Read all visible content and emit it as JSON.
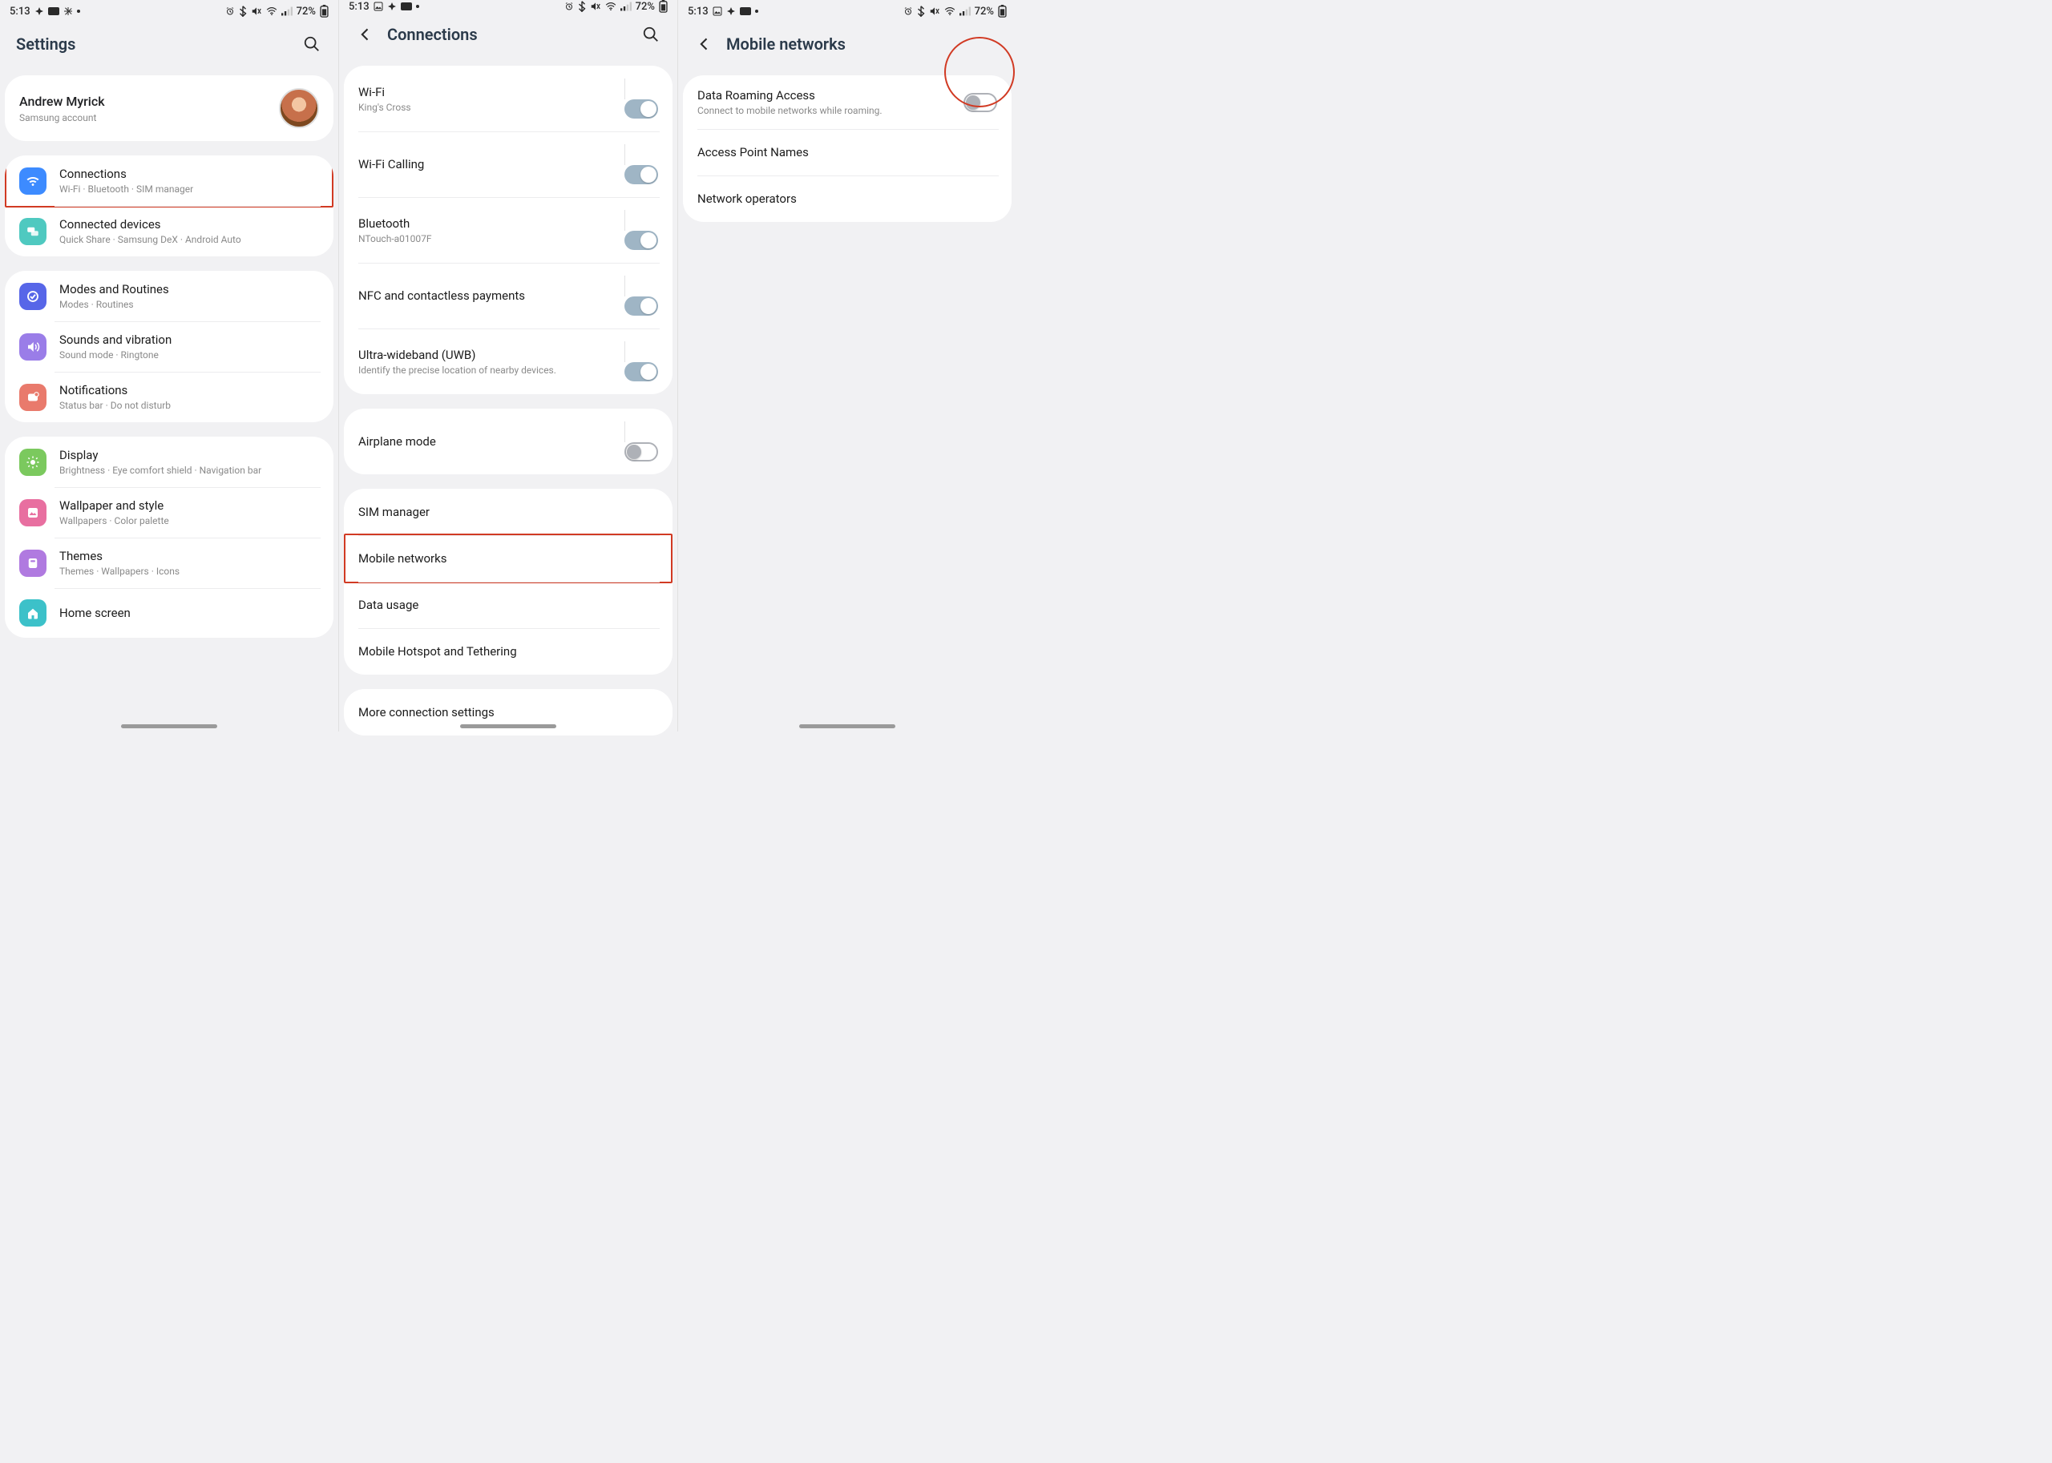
{
  "statusbar": {
    "time": "5:13",
    "battery": "72%"
  },
  "phone1": {
    "header": {
      "title": "Settings"
    },
    "account": {
      "name": "Andrew Myrick",
      "sub": "Samsung account"
    },
    "groups": [
      {
        "rows": [
          {
            "icon": "wifi",
            "title": "Connections",
            "sub": "Wi-Fi  ·  Bluetooth  ·  SIM manager",
            "hl": true
          },
          {
            "icon": "cd",
            "title": "Connected devices",
            "sub": "Quick Share  ·  Samsung DeX  ·  Android Auto"
          }
        ]
      },
      {
        "rows": [
          {
            "icon": "modes",
            "title": "Modes and Routines",
            "sub": "Modes  ·  Routines"
          },
          {
            "icon": "sound",
            "title": "Sounds and vibration",
            "sub": "Sound mode  ·  Ringtone"
          },
          {
            "icon": "notif",
            "title": "Notifications",
            "sub": "Status bar  ·  Do not disturb"
          }
        ]
      },
      {
        "rows": [
          {
            "icon": "disp",
            "title": "Display",
            "sub": "Brightness  ·  Eye comfort shield  ·  Navigation bar"
          },
          {
            "icon": "wall",
            "title": "Wallpaper and style",
            "sub": "Wallpapers  ·  Color palette"
          },
          {
            "icon": "theme",
            "title": "Themes",
            "sub": "Themes  ·  Wallpapers  ·  Icons"
          },
          {
            "icon": "home",
            "title": "Home screen",
            "sub": ""
          }
        ]
      }
    ]
  },
  "phone2": {
    "header": {
      "title": "Connections"
    },
    "groups": [
      {
        "rows": [
          {
            "title": "Wi-Fi",
            "sub": "King's Cross",
            "toggle": "on"
          },
          {
            "title": "Wi-Fi Calling",
            "toggle": "on"
          },
          {
            "title": "Bluetooth",
            "sub": "NTouch-a01007F",
            "toggle": "on"
          },
          {
            "title": "NFC and contactless payments",
            "toggle": "on"
          },
          {
            "title": "Ultra-wideband (UWB)",
            "sub": "Identify the precise location of nearby devices.",
            "toggle": "on"
          }
        ]
      },
      {
        "rows": [
          {
            "title": "Airplane mode",
            "toggle": "off-outline"
          }
        ]
      },
      {
        "rows": [
          {
            "title": "SIM manager"
          },
          {
            "title": "Mobile networks",
            "hl": true
          },
          {
            "title": "Data usage"
          },
          {
            "title": "Mobile Hotspot and Tethering"
          }
        ]
      },
      {
        "rows": [
          {
            "title": "More connection settings"
          }
        ]
      }
    ]
  },
  "phone3": {
    "header": {
      "title": "Mobile networks"
    },
    "groups": [
      {
        "rows": [
          {
            "title": "Data Roaming Access",
            "sub": "Connect to mobile networks while roaming.",
            "toggle": "off-outline",
            "circle": true
          },
          {
            "title": "Access Point Names"
          },
          {
            "title": "Network operators"
          }
        ]
      }
    ]
  }
}
